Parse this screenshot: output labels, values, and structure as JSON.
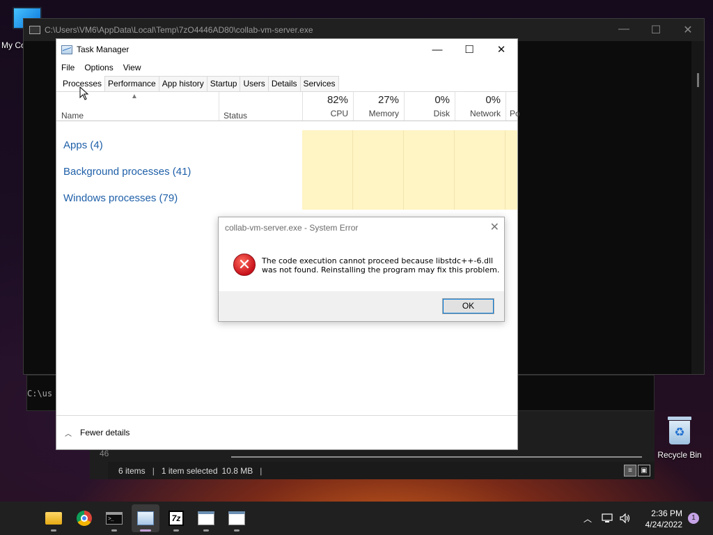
{
  "desktop": {
    "computer_icon_label": "My Co",
    "recycle_bin_label": "Recycle Bin"
  },
  "console": {
    "title": "C:\\Users\\VM6\\AppData\\Local\\Temp\\7zO4446AD80\\collab-vm-server.exe",
    "prompt_text": "C:\\us"
  },
  "background_window": {
    "partial_number": "46",
    "status_items": "6 items",
    "status_selected": "1 item selected",
    "status_size": "10.8 MB"
  },
  "task_manager": {
    "title": "Task Manager",
    "menu": [
      "File",
      "Options",
      "View"
    ],
    "tabs": [
      "Processes",
      "Performance",
      "App history",
      "Startup",
      "Users",
      "Details",
      "Services"
    ],
    "active_tab": "Processes",
    "columns": {
      "name": "Name",
      "status": "Status",
      "cpu_pct": "82%",
      "cpu_label": "CPU",
      "memory_pct": "27%",
      "memory_label": "Memory",
      "disk_pct": "0%",
      "disk_label": "Disk",
      "network_pct": "0%",
      "network_label": "Network",
      "power_label": "Po"
    },
    "groups": [
      "Apps (4)",
      "Background processes (41)",
      "Windows processes (79)"
    ],
    "fewer_details": "Fewer details"
  },
  "error_dialog": {
    "title": "collab-vm-server.exe - System Error",
    "message_line1": "The code execution cannot proceed because libstdc++-6.dll",
    "message_line2": "was not found. Reinstalling the program may fix this problem.",
    "ok_label": "OK"
  },
  "taskbar": {
    "apps": [
      "start-icon",
      "file-explorer-icon",
      "chrome-icon",
      "terminal-icon",
      "task-manager-icon",
      "7zip-icon",
      "window-app-icon",
      "window-app-icon"
    ],
    "time": "2:36 PM",
    "date": "4/24/2022",
    "notification_count": "1"
  }
}
